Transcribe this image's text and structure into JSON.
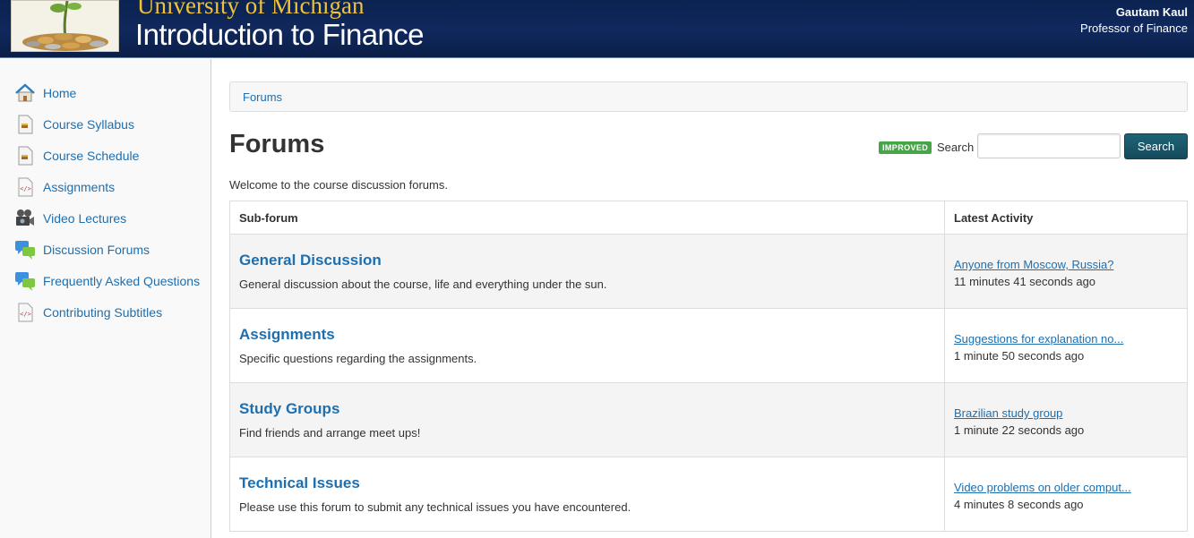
{
  "header": {
    "university": "University of Michigan",
    "course": "Introduction to Finance",
    "user_name": "Gautam Kaul",
    "user_role": "Professor of Finance"
  },
  "sidebar": {
    "items": [
      {
        "label": "Home",
        "icon": "home-icon"
      },
      {
        "label": "Course Syllabus",
        "icon": "document-icon"
      },
      {
        "label": "Course Schedule",
        "icon": "document-icon"
      },
      {
        "label": "Assignments",
        "icon": "code-file-icon"
      },
      {
        "label": "Video Lectures",
        "icon": "video-camera-icon"
      },
      {
        "label": "Discussion Forums",
        "icon": "chat-bubbles-icon"
      },
      {
        "label": "Frequently Asked Questions",
        "icon": "chat-bubbles-icon"
      },
      {
        "label": "Contributing Subtitles",
        "icon": "code-file-icon"
      }
    ]
  },
  "breadcrumb": {
    "label": "Forums"
  },
  "main": {
    "title": "Forums",
    "badge": "IMPROVED",
    "search_label": "Search",
    "search_value": "",
    "search_button": "Search",
    "welcome": "Welcome to the course discussion forums."
  },
  "table": {
    "headers": [
      "Sub-forum",
      "Latest Activity"
    ],
    "rows": [
      {
        "title": "General Discussion",
        "description": "General discussion about the course, life and everything under the sun.",
        "latest": "Anyone from Moscow, Russia?",
        "time": "11 minutes 41 seconds ago"
      },
      {
        "title": "Assignments",
        "description": "Specific questions regarding the assignments.",
        "latest": "Suggestions for explanation no...",
        "time": "1 minute 50 seconds ago"
      },
      {
        "title": "Study Groups",
        "description": "Find friends and arrange meet ups!",
        "latest": "Brazilian study group",
        "time": "1 minute 22 seconds ago"
      },
      {
        "title": "Technical Issues",
        "description": "Please use this forum to submit any technical issues you have encountered.",
        "latest": "Video problems on older comput...",
        "time": "4 minutes 8 seconds ago"
      }
    ]
  },
  "colors": {
    "header_bg": "#10285c",
    "university_gold": "#f0c238",
    "link_blue": "#1d6fb0",
    "badge_green": "#46a546",
    "search_button": "#1a576a"
  }
}
